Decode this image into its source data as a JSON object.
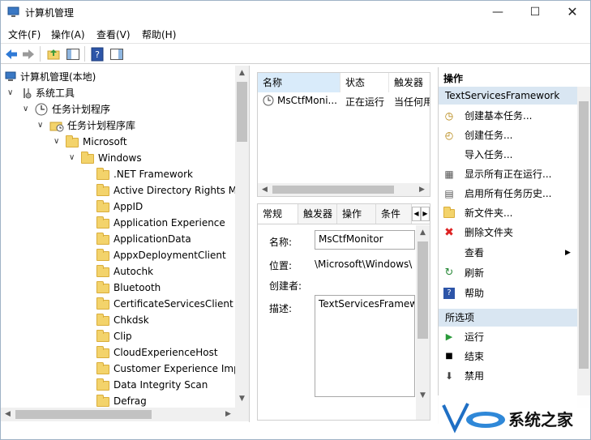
{
  "window": {
    "title": "计算机管理"
  },
  "menu": [
    "文件(F)",
    "操作(A)",
    "查看(V)",
    "帮助(H)"
  ],
  "tree": {
    "root": "计算机管理(本地)",
    "system_tools": "系统工具",
    "task_scheduler": "任务计划程序",
    "task_library": "任务计划程序库",
    "microsoft": "Microsoft",
    "windows": "Windows",
    "items": [
      ".NET Framework",
      "Active Directory Rights Ma",
      "AppID",
      "Application Experience",
      "ApplicationData",
      "AppxDeploymentClient",
      "Autochk",
      "Bluetooth",
      "CertificateServicesClient",
      "Chkdsk",
      "Clip",
      "CloudExperienceHost",
      "Customer Experience Imp",
      "Data Integrity Scan",
      "Defrag"
    ]
  },
  "task_list": {
    "columns": [
      "名称",
      "状态",
      "触发器"
    ],
    "rows": [
      {
        "name": "MsCtfMoni...",
        "status": "正在运行",
        "trigger": "当任何用"
      }
    ]
  },
  "detail": {
    "tabs": [
      "常规",
      "触发器",
      "操作",
      "条件"
    ],
    "name_label": "名称:",
    "name_value": "MsCtfMonitor",
    "location_label": "位置:",
    "location_value": "\\Microsoft\\Windows\\",
    "author_label": "创建者:",
    "desc_label": "描述:",
    "desc_value": "TextServicesFramewo"
  },
  "actions": {
    "header": "操作",
    "section1": "TextServicesFramework",
    "items1": [
      "创建基本任务...",
      "创建任务...",
      "导入任务...",
      "显示所有正在运行...",
      "启用所有任务历史...",
      "新文件夹...",
      "删除文件夹",
      "查看",
      "刷新",
      "帮助"
    ],
    "section2": "所选项",
    "items2": [
      "运行",
      "结束",
      "禁用"
    ]
  },
  "watermark": {
    "text": "系统之家"
  },
  "colors": {
    "selection": "#cce8ff",
    "accent": "#0078d7",
    "section_head": "#d9e6f2"
  }
}
